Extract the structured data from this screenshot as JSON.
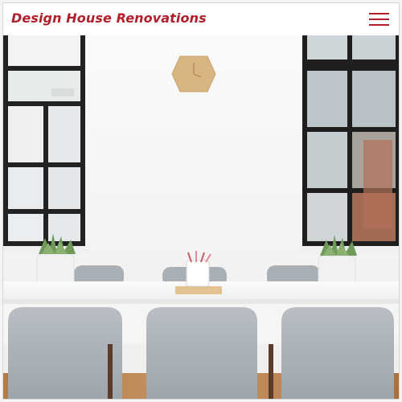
{
  "header": {
    "brand": "Design House Renovations",
    "menu_icon": "hamburger-menu-icon"
  },
  "colors": {
    "brand": "#b11f2a",
    "wall": "#f6f6f6",
    "window_frame": "#222222",
    "chair": "#aeb4b9",
    "table": "#f3f3f3",
    "plant": "#6f9a5a",
    "clock": "#d8b382"
  },
  "hero": {
    "image_subject": "dining-room-scene"
  }
}
